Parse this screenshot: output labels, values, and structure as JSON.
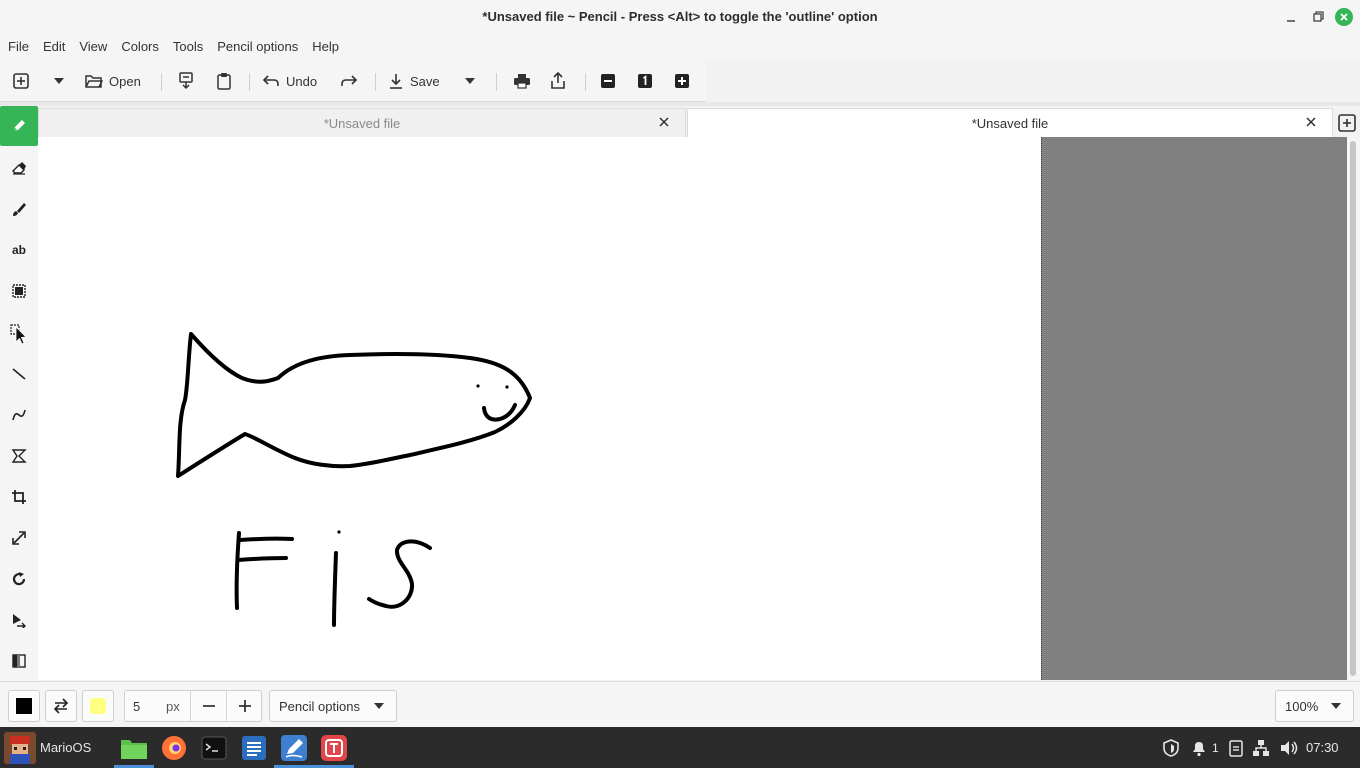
{
  "window": {
    "title": "*Unsaved file ~ Pencil - Press <Alt> to toggle the 'outline' option"
  },
  "menu": [
    "File",
    "Edit",
    "View",
    "Colors",
    "Tools",
    "Pencil options",
    "Help"
  ],
  "toolbar": {
    "open_label": "Open",
    "undo_label": "Undo",
    "save_label": "Save"
  },
  "tabs": [
    {
      "label": "*Unsaved file",
      "active": false
    },
    {
      "label": "*Unsaved file",
      "active": true
    }
  ],
  "tools": [
    {
      "name": "pencil-tool",
      "icon": "pencil-icon",
      "active": true
    },
    {
      "name": "eraser-tool",
      "icon": "eraser-icon"
    },
    {
      "name": "brush-tool",
      "icon": "brush-icon"
    },
    {
      "name": "text-tool",
      "icon": "text-icon",
      "label": "ab"
    },
    {
      "name": "rectangle-selection-tool",
      "icon": "rectangle-selection-icon"
    },
    {
      "name": "free-selection-tool",
      "icon": "free-selection-icon"
    },
    {
      "name": "line-tool",
      "icon": "line-icon"
    },
    {
      "name": "curve-tool",
      "icon": "curve-icon"
    },
    {
      "name": "shape-tool",
      "icon": "shape-icon"
    },
    {
      "name": "crop-tool",
      "icon": "crop-icon"
    },
    {
      "name": "scale-tool",
      "icon": "scale-icon"
    },
    {
      "name": "rotate-tool",
      "icon": "rotate-icon"
    },
    {
      "name": "skew-tool",
      "icon": "skew-icon"
    },
    {
      "name": "filters-tool",
      "icon": "filters-icon"
    }
  ],
  "bottom": {
    "main_color": "#000000",
    "secondary_color": "#ffff80",
    "size_value": "5",
    "size_unit": "px",
    "options_label": "Pencil options",
    "zoom": "100%"
  },
  "taskbar": {
    "menu_label": "MarioOS",
    "notifications_count": "1",
    "clock": "07:30"
  },
  "colors": {
    "accent": "#35b556",
    "outside_canvas": "#808080"
  }
}
